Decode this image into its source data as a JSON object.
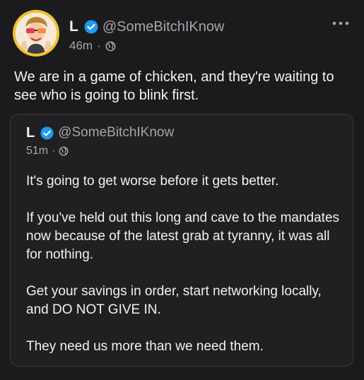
{
  "post": {
    "author_name": "L",
    "handle": "@SomeBitchIKnow",
    "timestamp": "46m",
    "separator": "·",
    "visibility_icon": "globe-icon",
    "more_icon": "more-horizontal-icon",
    "verified_icon": "verified-badge-icon",
    "text": "We are in a game of chicken, and they're waiting to see who is going to blink first."
  },
  "quoted": {
    "author_name": "L",
    "handle": "@SomeBitchIKnow",
    "timestamp": "51m",
    "separator": "·",
    "paragraphs": [
      "It's going to get worse before it gets better.",
      "If you've held out this long and cave to the mandates now because of the latest grab at tyranny, it was all for nothing.",
      "Get your savings in order, start networking locally, and DO NOT GIVE IN.",
      "They need us more than we need them."
    ]
  },
  "colors": {
    "background": "#1b1b1d",
    "card_background": "#202022",
    "verified_blue": "#1d9bf0",
    "secondary_text": "#a6a6aa",
    "avatar_ring": "#f1c232"
  }
}
